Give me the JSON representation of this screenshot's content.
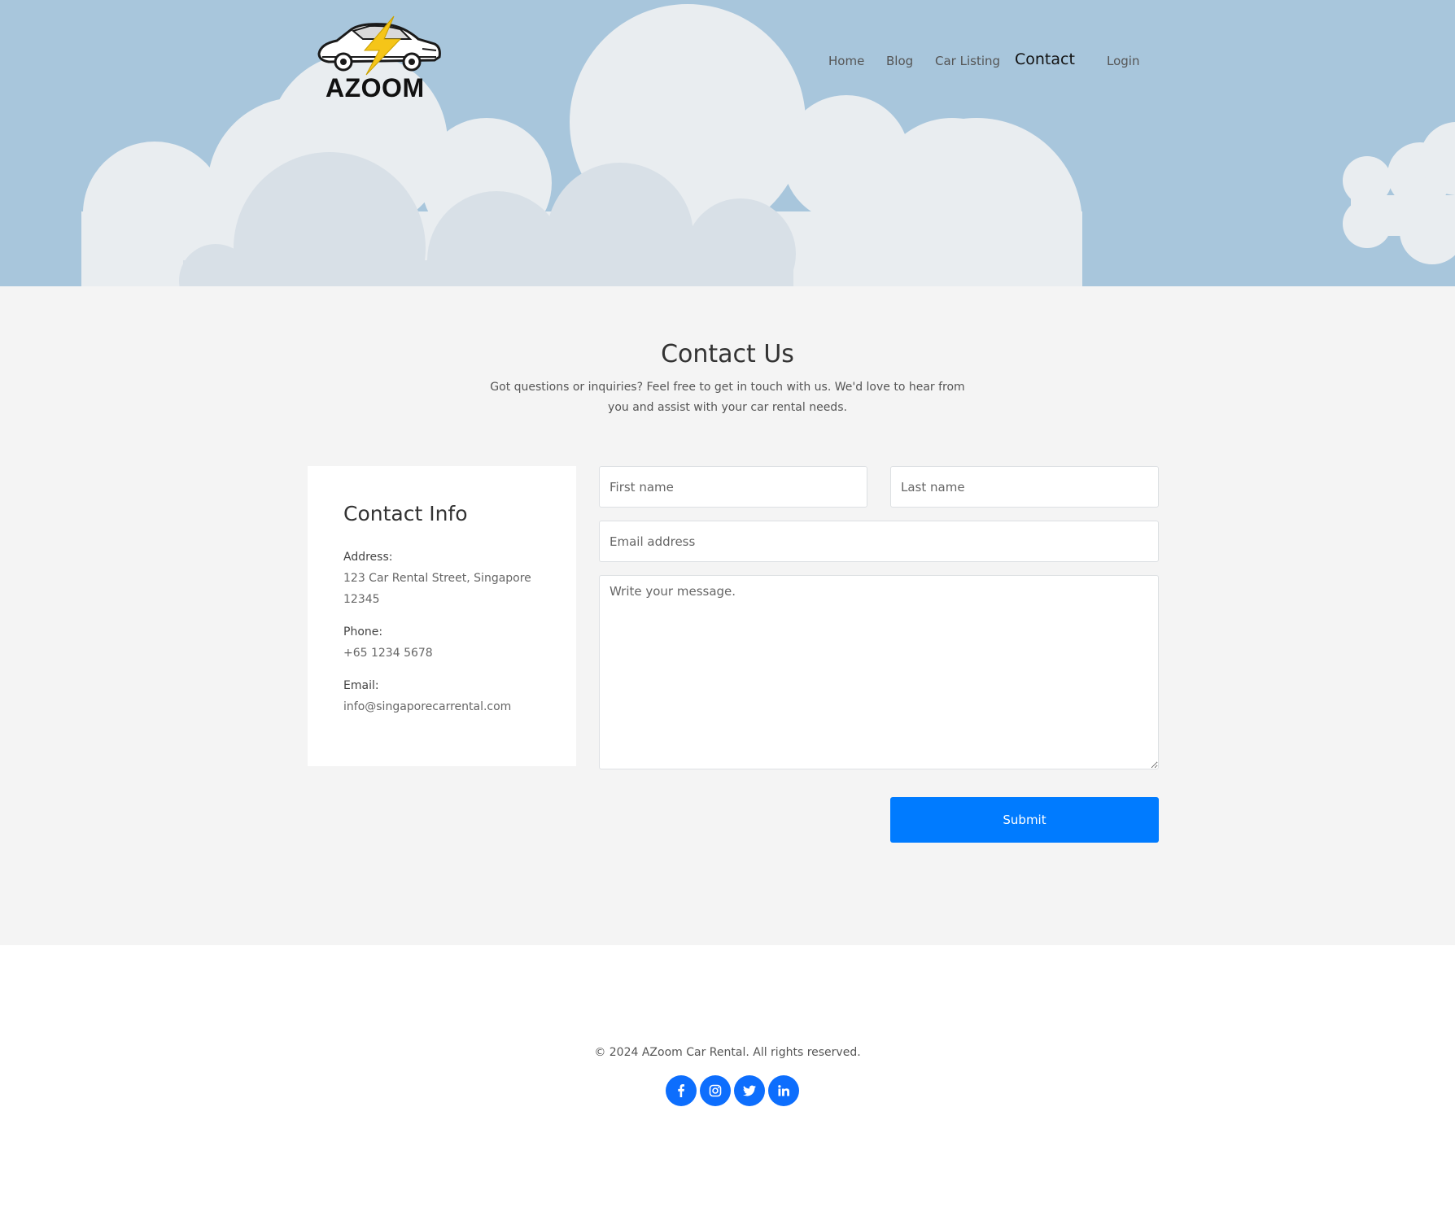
{
  "brand": {
    "name": "AZOOM",
    "accent_color": "#f5c518",
    "sky_color": "#a8c6dc"
  },
  "nav": {
    "items": [
      {
        "label": "Home"
      },
      {
        "label": "Blog"
      },
      {
        "label": "Car Listing"
      },
      {
        "label": "Contact",
        "active": true
      },
      {
        "label": "Login"
      }
    ]
  },
  "contact_section": {
    "title": "Contact Us",
    "subtitle": "Got questions or inquiries? Feel free to get in touch with us. We'd love to hear from you and assist with your car rental needs."
  },
  "contact_info": {
    "title": "Contact Info",
    "address_label": "Address:",
    "address_value": "123 Car Rental Street, Singapore 12345",
    "phone_label": "Phone:",
    "phone_value": "+65 1234 5678",
    "email_label": "Email:",
    "email_value": "info@singaporecarrental.com"
  },
  "form": {
    "first_name_placeholder": "First name",
    "last_name_placeholder": "Last name",
    "email_placeholder": "Email address",
    "message_placeholder": "Write your message.",
    "submit_label": "Submit",
    "submit_color": "#007bff"
  },
  "footer": {
    "copyright": "© 2024 AZoom Car Rental. All rights reserved.",
    "socials": [
      {
        "icon": "facebook-icon"
      },
      {
        "icon": "instagram-icon"
      },
      {
        "icon": "twitter-icon"
      },
      {
        "icon": "linkedin-icon"
      }
    ]
  }
}
